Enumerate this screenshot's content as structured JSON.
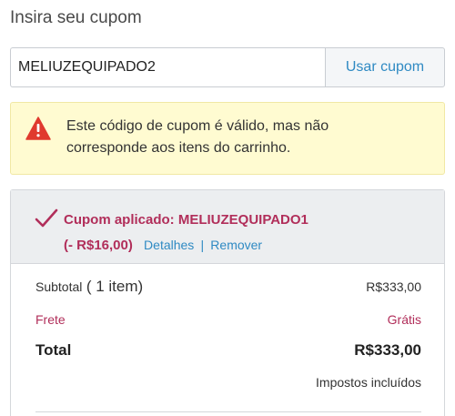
{
  "coupon": {
    "title": "Insira seu cupom",
    "input_value": "MELIUZEQUIPADO2",
    "apply_label": "Usar cupom"
  },
  "alert": {
    "icon": "warning-triangle-icon",
    "message": "Este código de cupom é válido, mas não corresponde aos itens do carrinho."
  },
  "applied_coupon": {
    "icon": "checkmark-icon",
    "label": "Cupom aplicado: MELIUZEQUIPADO1",
    "discount": "(- R$16,00)",
    "details_label": "Detalhes",
    "separator": "|",
    "remove_label": "Remover"
  },
  "summary": {
    "subtotal_label": "Subtotal",
    "subtotal_count": "( 1 item)",
    "subtotal_value": "R$333,00",
    "shipping_label": "Frete",
    "shipping_value": "Grátis",
    "total_label": "Total",
    "total_value": "R$333,00",
    "taxes_note": "Impostos incluídos"
  },
  "colors": {
    "accent_link": "#2f8ac3",
    "coupon_red": "#b12e5a",
    "warning_red": "#e03a2e",
    "alert_bg": "#fffbd1"
  }
}
